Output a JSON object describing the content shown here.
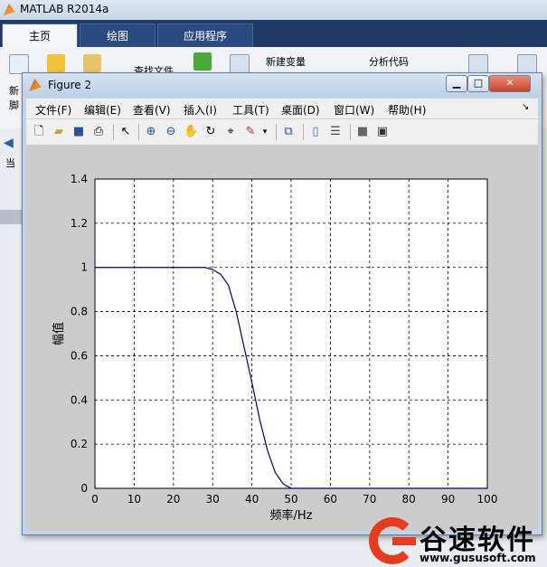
{
  "matlab": {
    "title": "MATLAB R2014a",
    "tabs": [
      "主页",
      "绘图",
      "应用程序"
    ],
    "ribbon": {
      "new_variable": "新建变量",
      "analyze_code": "分析代码",
      "find_files": "查找文件",
      "new_short": "新",
      "script_short": "脚",
      "current_short": "当"
    }
  },
  "figure": {
    "title": "Figure 2",
    "menus": [
      "文件(F)",
      "编辑(E)",
      "查看(V)",
      "插入(I)",
      "工具(T)",
      "桌面(D)",
      "窗口(W)",
      "帮助(H)"
    ],
    "window_buttons": {
      "minimize": "▁",
      "maximize": "□",
      "close": "✕"
    }
  },
  "chart_data": {
    "type": "line",
    "title": "",
    "xlabel": "频率/Hz",
    "ylabel": "幅值",
    "xlim": [
      0,
      100
    ],
    "ylim": [
      0,
      1.4
    ],
    "xticks": [
      "0",
      "10",
      "20",
      "30",
      "40",
      "50",
      "60",
      "70",
      "80",
      "90",
      "100"
    ],
    "yticks": [
      "0",
      "0.2",
      "0.4",
      "0.6",
      "0.8",
      "1",
      "1.2",
      "1.4"
    ],
    "grid": true,
    "series": [
      {
        "color": "#00007f",
        "x": [
          0,
          10,
          20,
          25,
          28,
          30,
          32,
          34,
          36,
          38,
          40,
          42,
          44,
          46,
          48,
          50,
          55,
          60,
          70,
          80,
          90,
          100
        ],
        "y": [
          1,
          1,
          1,
          1,
          1,
          0.99,
          0.97,
          0.92,
          0.8,
          0.64,
          0.48,
          0.31,
          0.17,
          0.07,
          0.02,
          0,
          0,
          0,
          0,
          0,
          0,
          0
        ]
      }
    ]
  },
  "watermark": {
    "brand": "谷速软件",
    "url": "www.gususoft.com"
  }
}
